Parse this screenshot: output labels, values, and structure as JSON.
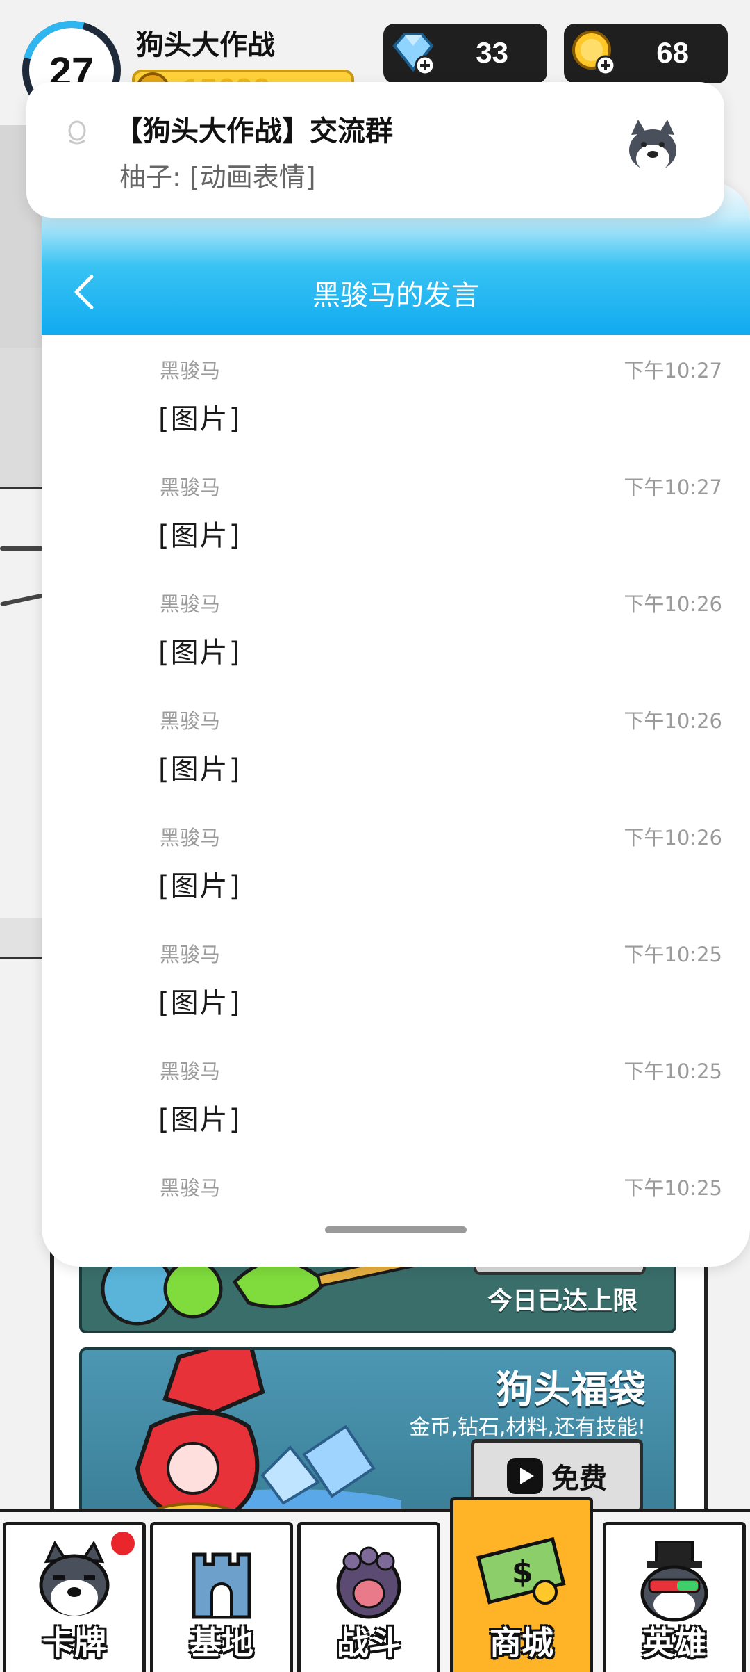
{
  "hud": {
    "level": "27",
    "game_name": "狗头大作战",
    "score": "15699",
    "gems": "33",
    "gold": "68"
  },
  "notification": {
    "title": "【狗头大作战】交流群",
    "body": "柚子: [动画表情]"
  },
  "chat": {
    "title": "黑骏马的发言",
    "messages": [
      {
        "sender": "黑骏马",
        "time": "下午10:27",
        "text": "[图片]"
      },
      {
        "sender": "黑骏马",
        "time": "下午10:27",
        "text": "[图片]"
      },
      {
        "sender": "黑骏马",
        "time": "下午10:26",
        "text": "[图片]"
      },
      {
        "sender": "黑骏马",
        "time": "下午10:26",
        "text": "[图片]"
      },
      {
        "sender": "黑骏马",
        "time": "下午10:26",
        "text": "[图片]"
      },
      {
        "sender": "黑骏马",
        "time": "下午10:25",
        "text": "[图片]"
      },
      {
        "sender": "黑骏马",
        "time": "下午10:25",
        "text": "[图片]"
      },
      {
        "sender": "黑骏马",
        "time": "下午10:25",
        "text": ""
      }
    ]
  },
  "shop": {
    "card1_limit": "今日已达上限",
    "card2_title": "狗头福袋",
    "card2_desc": "金币,钻石,材料,还有技能!",
    "free_label": "免费"
  },
  "nav": {
    "tabs": [
      {
        "label": "卡牌",
        "icon": "dog-face-icon"
      },
      {
        "label": "基地",
        "icon": "castle-icon"
      },
      {
        "label": "战斗",
        "icon": "paw-icon"
      },
      {
        "label": "商城",
        "icon": "money-icon"
      },
      {
        "label": "英雄",
        "icon": "hero-icon"
      }
    ]
  },
  "colors": {
    "header_blue": "#11aaf0",
    "nav_active": "#ffb428",
    "badge_red": "#e8262b"
  }
}
